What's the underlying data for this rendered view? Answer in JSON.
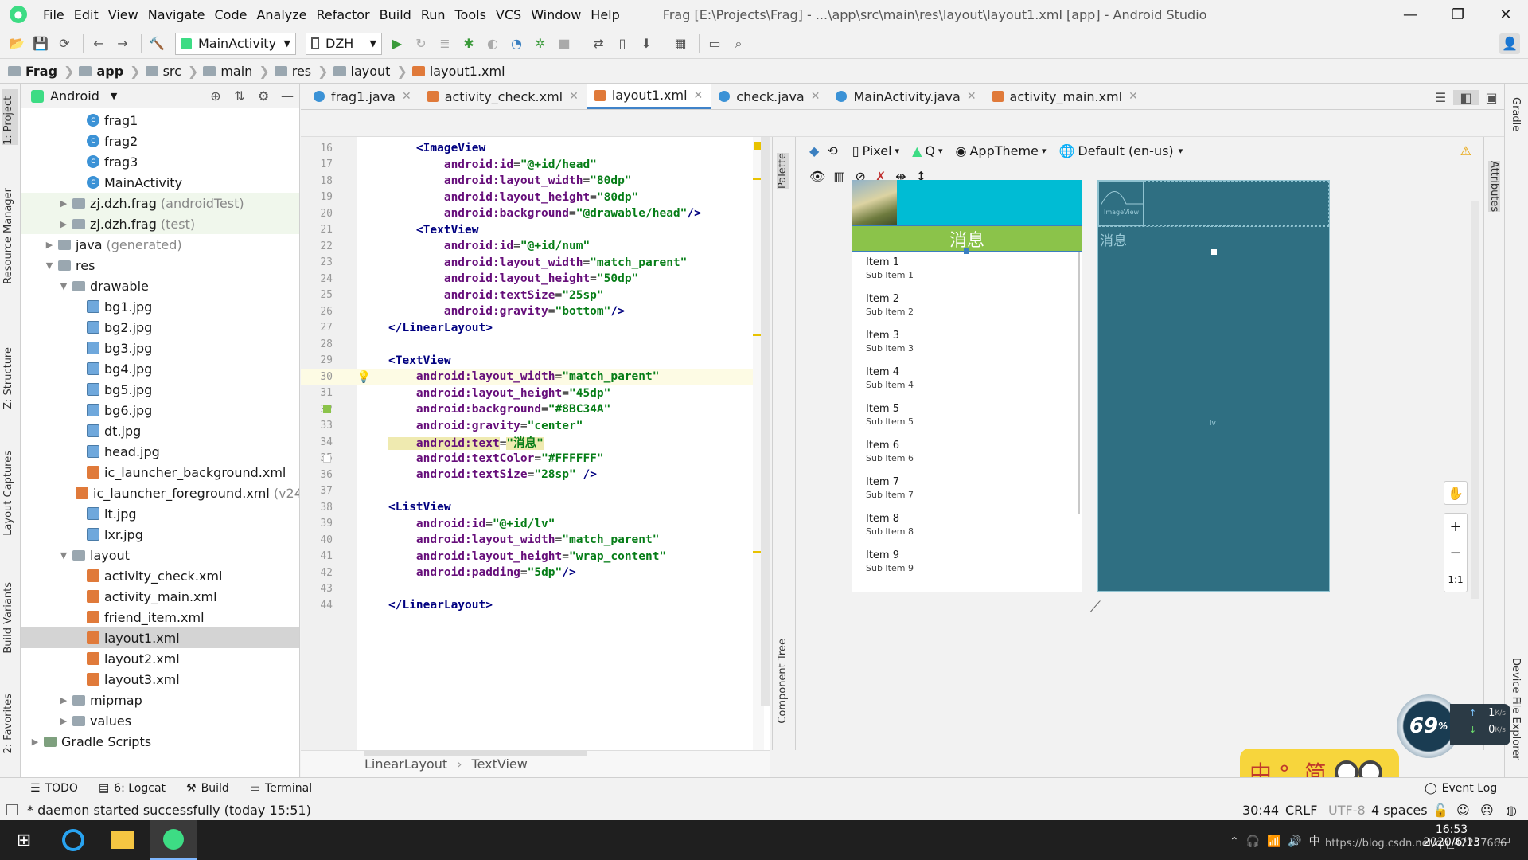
{
  "menubar": {
    "items": [
      "File",
      "Edit",
      "View",
      "Navigate",
      "Code",
      "Analyze",
      "Refactor",
      "Build",
      "Run",
      "Tools",
      "VCS",
      "Window",
      "Help"
    ],
    "window_title": "Frag [E:\\Projects\\Frag] - ...\\app\\src\\main\\res\\layout\\layout1.xml [app] - Android Studio",
    "minimize": "—",
    "maximize": "❐",
    "close": "✕"
  },
  "toolbar": {
    "run_config": "MainActivity",
    "device": "DZH"
  },
  "breadcrumb": [
    "Frag",
    "app",
    "src",
    "main",
    "res",
    "layout",
    "layout1.xml"
  ],
  "left_strip": {
    "tabs": [
      "1: Project",
      "Resource Manager",
      "Z: Structure",
      "Layout Captures",
      "Build Variants",
      "2: Favorites"
    ]
  },
  "project_panel": {
    "view_mode": "Android",
    "tree": [
      {
        "label": "frag1",
        "icon": "class",
        "indent": 3
      },
      {
        "label": "frag2",
        "icon": "class",
        "indent": 3
      },
      {
        "label": "frag3",
        "icon": "class",
        "indent": 3
      },
      {
        "label": "MainActivity",
        "icon": "class",
        "indent": 3
      },
      {
        "label": "zj.dzh.frag",
        "suffix": "(androidTest)",
        "icon": "folder",
        "indent": 2,
        "collapsed": true,
        "green": true
      },
      {
        "label": "zj.dzh.frag",
        "suffix": "(test)",
        "icon": "folder",
        "indent": 2,
        "collapsed": true,
        "green": true
      },
      {
        "label": "java",
        "suffix": "(generated)",
        "icon": "folder",
        "indent": 1,
        "collapsed": true
      },
      {
        "label": "res",
        "icon": "folder",
        "indent": 1,
        "expanded": true
      },
      {
        "label": "drawable",
        "icon": "folder",
        "indent": 2,
        "expanded": true
      },
      {
        "label": "bg1.jpg",
        "icon": "img",
        "indent": 3
      },
      {
        "label": "bg2.jpg",
        "icon": "img",
        "indent": 3
      },
      {
        "label": "bg3.jpg",
        "icon": "img",
        "indent": 3
      },
      {
        "label": "bg4.jpg",
        "icon": "img",
        "indent": 3
      },
      {
        "label": "bg5.jpg",
        "icon": "img",
        "indent": 3
      },
      {
        "label": "bg6.jpg",
        "icon": "img",
        "indent": 3
      },
      {
        "label": "dt.jpg",
        "icon": "img",
        "indent": 3
      },
      {
        "label": "head.jpg",
        "icon": "img",
        "indent": 3
      },
      {
        "label": "ic_launcher_background.xml",
        "icon": "xml",
        "indent": 3
      },
      {
        "label": "ic_launcher_foreground.xml",
        "suffix": "(v24",
        "icon": "xml",
        "indent": 3
      },
      {
        "label": "lt.jpg",
        "icon": "img",
        "indent": 3
      },
      {
        "label": "lxr.jpg",
        "icon": "img",
        "indent": 3
      },
      {
        "label": "layout",
        "icon": "folder",
        "indent": 2,
        "expanded": true
      },
      {
        "label": "activity_check.xml",
        "icon": "xml",
        "indent": 3
      },
      {
        "label": "activity_main.xml",
        "icon": "xml",
        "indent": 3
      },
      {
        "label": "friend_item.xml",
        "icon": "xml",
        "indent": 3
      },
      {
        "label": "layout1.xml",
        "icon": "xml",
        "indent": 3,
        "selected": true
      },
      {
        "label": "layout2.xml",
        "icon": "xml",
        "indent": 3
      },
      {
        "label": "layout3.xml",
        "icon": "xml",
        "indent": 3
      },
      {
        "label": "mipmap",
        "icon": "folder",
        "indent": 2,
        "collapsed": true
      },
      {
        "label": "values",
        "icon": "folder",
        "indent": 2,
        "collapsed": true
      },
      {
        "label": "Gradle Scripts",
        "icon": "gradle",
        "indent": 0,
        "collapsed": true
      }
    ]
  },
  "editor_tabs": [
    {
      "label": "frag1.java",
      "type": "class"
    },
    {
      "label": "activity_check.xml",
      "type": "xml"
    },
    {
      "label": "layout1.xml",
      "type": "xml",
      "active": true
    },
    {
      "label": "check.java",
      "type": "class"
    },
    {
      "label": "MainActivity.java",
      "type": "class"
    },
    {
      "label": "activity_main.xml",
      "type": "xml"
    }
  ],
  "code_lines": [
    {
      "n": "16",
      "parts": [
        [
          "tag",
          "    <ImageView"
        ]
      ]
    },
    {
      "n": "17",
      "parts": [
        [
          "attr",
          "        android:id"
        ],
        [
          "txt",
          "="
        ],
        [
          "str",
          "\"@+id/head\""
        ]
      ]
    },
    {
      "n": "18",
      "parts": [
        [
          "attr",
          "        android:layout_width"
        ],
        [
          "txt",
          "="
        ],
        [
          "str",
          "\"80dp\""
        ]
      ]
    },
    {
      "n": "19",
      "parts": [
        [
          "attr",
          "        android:layout_height"
        ],
        [
          "txt",
          "="
        ],
        [
          "str",
          "\"80dp\""
        ]
      ]
    },
    {
      "n": "20",
      "parts": [
        [
          "attr",
          "        android:background"
        ],
        [
          "txt",
          "="
        ],
        [
          "str",
          "\"@drawable/head\""
        ],
        [
          "tag",
          "/>"
        ]
      ]
    },
    {
      "n": "21",
      "parts": [
        [
          "tag",
          "    <TextView"
        ]
      ]
    },
    {
      "n": "22",
      "parts": [
        [
          "attr",
          "        android:id"
        ],
        [
          "txt",
          "="
        ],
        [
          "str",
          "\"@+id/num\""
        ]
      ]
    },
    {
      "n": "23",
      "parts": [
        [
          "attr",
          "        android:layout_width"
        ],
        [
          "txt",
          "="
        ],
        [
          "str",
          "\"match_parent\""
        ]
      ]
    },
    {
      "n": "24",
      "parts": [
        [
          "attr",
          "        android:layout_height"
        ],
        [
          "txt",
          "="
        ],
        [
          "str",
          "\"50dp\""
        ]
      ]
    },
    {
      "n": "25",
      "parts": [
        [
          "attr",
          "        android:textSize"
        ],
        [
          "txt",
          "="
        ],
        [
          "str",
          "\"25sp\""
        ]
      ]
    },
    {
      "n": "26",
      "parts": [
        [
          "attr",
          "        android:gravity"
        ],
        [
          "txt",
          "="
        ],
        [
          "str",
          "\"bottom\""
        ],
        [
          "tag",
          "/>"
        ]
      ]
    },
    {
      "n": "27",
      "parts": [
        [
          "tag",
          "</LinearLayout>"
        ]
      ]
    },
    {
      "n": "28",
      "parts": []
    },
    {
      "n": "29",
      "parts": [
        [
          "tag",
          "<TextView"
        ]
      ]
    },
    {
      "n": "30",
      "parts": [
        [
          "attr",
          "    android:layout_width"
        ],
        [
          "txt",
          "="
        ],
        [
          "str",
          "\"match_parent\""
        ]
      ],
      "current": true
    },
    {
      "n": "31",
      "parts": [
        [
          "attr",
          "    android:layout_height"
        ],
        [
          "txt",
          "="
        ],
        [
          "str",
          "\"45dp\""
        ]
      ]
    },
    {
      "n": "32",
      "parts": [
        [
          "attr",
          "    android:background"
        ],
        [
          "txt",
          "="
        ],
        [
          "str",
          "\"#8BC34A\""
        ]
      ]
    },
    {
      "n": "33",
      "parts": [
        [
          "attr",
          "    android:gravity"
        ],
        [
          "txt",
          "="
        ],
        [
          "str",
          "\"center\""
        ]
      ]
    },
    {
      "n": "34",
      "parts": [
        [
          "attrhl",
          "    android:text"
        ],
        [
          "txt",
          "="
        ],
        [
          "strhl",
          "\"消息\""
        ]
      ]
    },
    {
      "n": "35",
      "parts": [
        [
          "attr",
          "    android:textColor"
        ],
        [
          "txt",
          "="
        ],
        [
          "str",
          "\"#FFFFFF\""
        ]
      ]
    },
    {
      "n": "36",
      "parts": [
        [
          "attr",
          "    android:textSize"
        ],
        [
          "txt",
          "="
        ],
        [
          "str",
          "\"28sp\""
        ],
        [
          "tag",
          " />"
        ]
      ]
    },
    {
      "n": "37",
      "parts": []
    },
    {
      "n": "38",
      "parts": [
        [
          "tag",
          "<ListView"
        ]
      ]
    },
    {
      "n": "39",
      "parts": [
        [
          "attr",
          "    android:id"
        ],
        [
          "txt",
          "="
        ],
        [
          "str",
          "\"@+id/lv\""
        ]
      ]
    },
    {
      "n": "40",
      "parts": [
        [
          "attr",
          "    android:layout_width"
        ],
        [
          "txt",
          "="
        ],
        [
          "str",
          "\"match_parent\""
        ]
      ]
    },
    {
      "n": "41",
      "parts": [
        [
          "attr",
          "    android:layout_height"
        ],
        [
          "txt",
          "="
        ],
        [
          "str",
          "\"wrap_content\""
        ]
      ]
    },
    {
      "n": "42",
      "parts": [
        [
          "attr",
          "    android:padding"
        ],
        [
          "txt",
          "="
        ],
        [
          "str",
          "\"5dp\""
        ],
        [
          "tag",
          "/>"
        ]
      ]
    },
    {
      "n": "43",
      "parts": []
    },
    {
      "n": "44",
      "parts": [
        [
          "tag",
          "</LinearLayout>"
        ]
      ]
    }
  ],
  "palette_strip": {
    "palette": "Palette",
    "component_tree": "Component Tree"
  },
  "design_toolbar": {
    "device": "Pixel",
    "api": "Q",
    "theme": "AppTheme",
    "locale": "Default (en-us)"
  },
  "preview": {
    "title_text": "消息",
    "title_bg": "#8BC34A",
    "header_bg": "#00BCD4",
    "items": [
      {
        "title": "Item 1",
        "sub": "Sub Item 1"
      },
      {
        "title": "Item 2",
        "sub": "Sub Item 2"
      },
      {
        "title": "Item 3",
        "sub": "Sub Item 3"
      },
      {
        "title": "Item 4",
        "sub": "Sub Item 4"
      },
      {
        "title": "Item 5",
        "sub": "Sub Item 5"
      },
      {
        "title": "Item 6",
        "sub": "Sub Item 6"
      },
      {
        "title": "Item 7",
        "sub": "Sub Item 7"
      },
      {
        "title": "Item 8",
        "sub": "Sub Item 8"
      },
      {
        "title": "Item 9",
        "sub": "Sub Item 9"
      }
    ]
  },
  "blueprint": {
    "imageview_label": "ImageView",
    "title_text": "消息",
    "lv_label": "lv"
  },
  "zoom_controls": {
    "zoom_in": "+",
    "zoom_out": "−",
    "actual": "1:1"
  },
  "right_strip": {
    "gradle": "Gradle",
    "attributes": "Attributes",
    "device_explorer": "Device File Explorer"
  },
  "overlay": {
    "percent": "69",
    "up_speed": "1",
    "up_unit": "K/s",
    "down_speed": "0",
    "down_unit": "K/s",
    "ime_text": "中 °, 简"
  },
  "path_bar": [
    "LinearLayout",
    "TextView"
  ],
  "bottom_tabs": [
    "TODO",
    "6: Logcat",
    "Build",
    "Terminal"
  ],
  "event_log": "Event Log",
  "status": {
    "message": "* daemon started successfully (today 15:51)",
    "position": "30:44",
    "line_sep": "CRLF",
    "encoding": "UTF-8",
    "indent": "4 spaces"
  },
  "taskbar": {
    "time": "16:53",
    "date": "2020/6/13",
    "watermark": "https://blog.csdn.net/qq_42257666"
  }
}
